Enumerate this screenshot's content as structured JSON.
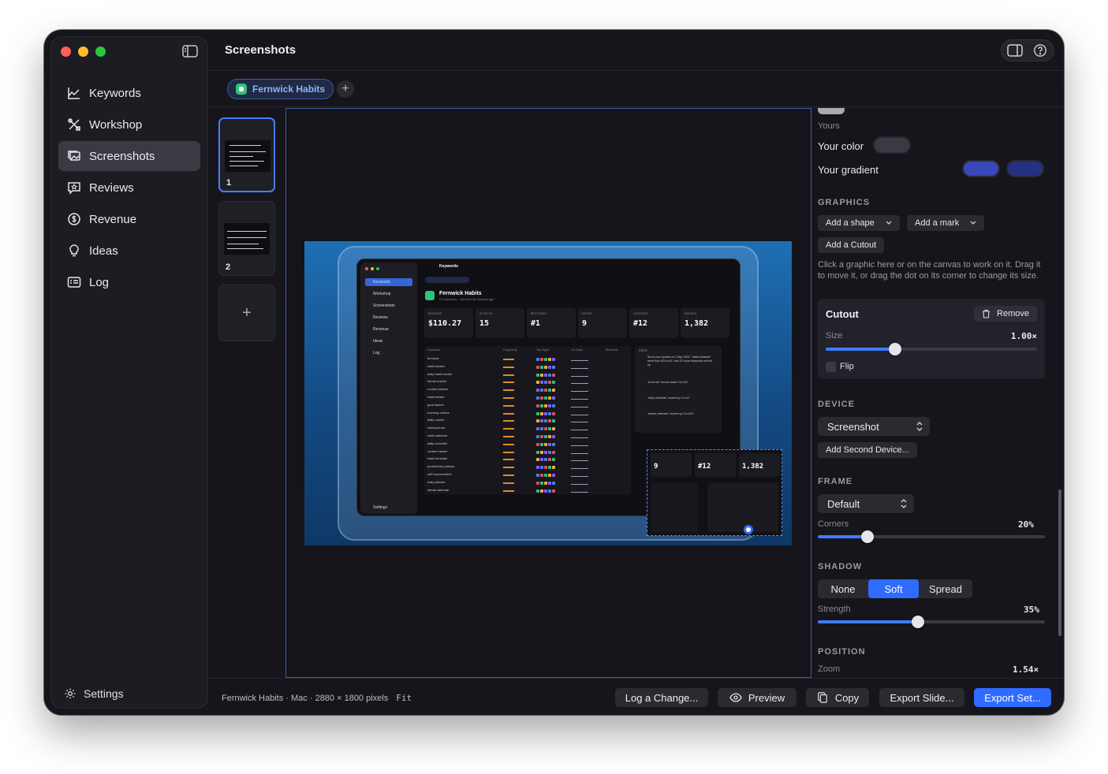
{
  "sidebar": {
    "items": [
      {
        "label": "Keywords"
      },
      {
        "label": "Workshop"
      },
      {
        "label": "Screenshots"
      },
      {
        "label": "Reviews"
      },
      {
        "label": "Revenue"
      },
      {
        "label": "Ideas"
      },
      {
        "label": "Log"
      }
    ],
    "settings_label": "Settings"
  },
  "header": {
    "title": "Screenshots"
  },
  "tabs": {
    "app_tab": "Fernwick Habits",
    "add": "+"
  },
  "thumbnails": {
    "items": [
      {
        "number": "1"
      },
      {
        "number": "2"
      }
    ],
    "add": "+"
  },
  "preview": {
    "sidebar_items": [
      "Keywords",
      "Workshop",
      "Screenshots",
      "Reviews",
      "Revenue",
      "Ideas",
      "Log"
    ],
    "settings": "Settings",
    "header": "Keywords",
    "app_title": "Fernwick Habits",
    "app_subtitle": "27 keywords · checked 35 minutes ago",
    "stats": [
      {
        "label": "REVENUE",
        "value": "$110.27"
      },
      {
        "label": "IN TOP 10",
        "value": "15"
      },
      {
        "label": "BEST RANK",
        "value": "#1"
      },
      {
        "label": "MOVES",
        "value": "9"
      },
      {
        "label": "CATEGORY",
        "value": "#12"
      },
      {
        "label": "RATINGS",
        "value": "1,382"
      }
    ],
    "table_headers": [
      "Keyword",
      "Popularity",
      "Top Apps",
      "14 Days",
      "Beecroft..."
    ],
    "keywords": [
      "fernwick",
      "habit tracker",
      "daily habit tracker",
      "streak tracker",
      "routine planner",
      "habit builder",
      "goal tracker",
      "morning routine",
      "daily routine",
      "habit journal",
      "habit calendar",
      "daily checklist",
      "routine tracker",
      "habit reminder",
      "productivity planner",
      "self improvement",
      "daily planner",
      "streak calendar"
    ],
    "feed_title": "FEED",
    "feed": [
      "Since your update on 2 Sep 2026: \"habit reminder\" went from #24 to #2, and 20 more keywords moved up.",
      "\"to do list\" moved down 2 to #47",
      "\"daily checklist\" moved up 2 to #7",
      "\"streak calendar\" moved up 2 to #10"
    ]
  },
  "inspector": {
    "yours_label": "Yours",
    "your_color_label": "Your color",
    "your_gradient_label": "Your gradient",
    "swatch_color": "#3a3a42",
    "gradient_colors": [
      "#3848b8",
      "#263080"
    ],
    "graphics": {
      "heading": "GRAPHICS",
      "add_shape": "Add a shape",
      "add_mark": "Add a mark",
      "add_cutout": "Add a Cutout",
      "help": "Click a graphic here or on the canvas to work on it. Drag it to move it, or drag the dot on its corner to change its size."
    },
    "cutout": {
      "title": "Cutout",
      "remove": "Remove",
      "size_label": "Size",
      "size_value": "1.00×",
      "size_fraction": 0.33,
      "flip_label": "Flip"
    },
    "device": {
      "heading": "DEVICE",
      "selected": "Screenshot",
      "add_second": "Add Second Device..."
    },
    "frame": {
      "heading": "FRAME",
      "selected": "Default",
      "corners_label": "Corners",
      "corners_value": "20%",
      "corners_fraction": 0.22
    },
    "shadow": {
      "heading": "SHADOW",
      "options": [
        "None",
        "Soft",
        "Spread"
      ],
      "selected": "Soft",
      "strength_label": "Strength",
      "strength_value": "35%",
      "strength_fraction": 0.44
    },
    "position": {
      "heading": "POSITION",
      "zoom_label": "Zoom",
      "zoom_value": "1.54×"
    }
  },
  "footer": {
    "info": "Fernwick Habits · Mac · 2880 × 1800 pixels",
    "fit": "Fit",
    "log_change": "Log a Change...",
    "preview": "Preview",
    "copy": "Copy",
    "export_slide": "Export Slide...",
    "export_set": "Export Set..."
  },
  "colors": {
    "accent": "#2f6bff",
    "background": "#15151b",
    "sidebar": "#1c1c22"
  }
}
